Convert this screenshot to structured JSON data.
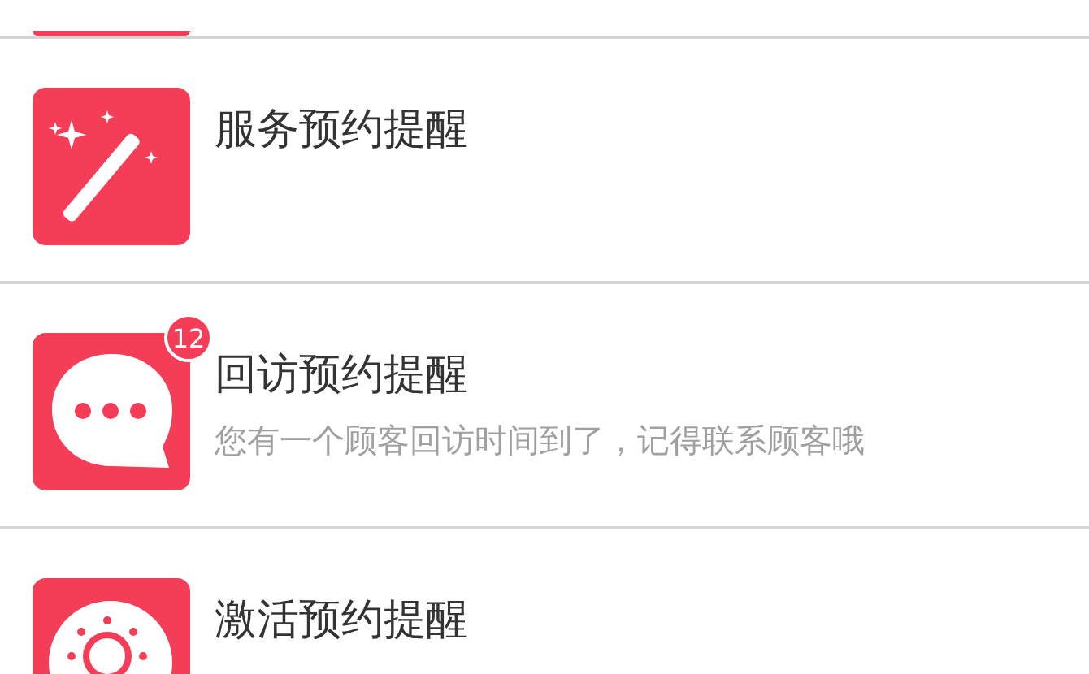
{
  "reminders": [
    {
      "kind": "partial"
    },
    {
      "kind": "full",
      "title": "服务预约提醒"
    },
    {
      "kind": "full",
      "title": "回访预约提醒",
      "badge": "12",
      "subtitle": "您有一个顾客回访时间到了，记得联系顾客哦"
    },
    {
      "kind": "full",
      "title": "激活预约提醒"
    }
  ]
}
